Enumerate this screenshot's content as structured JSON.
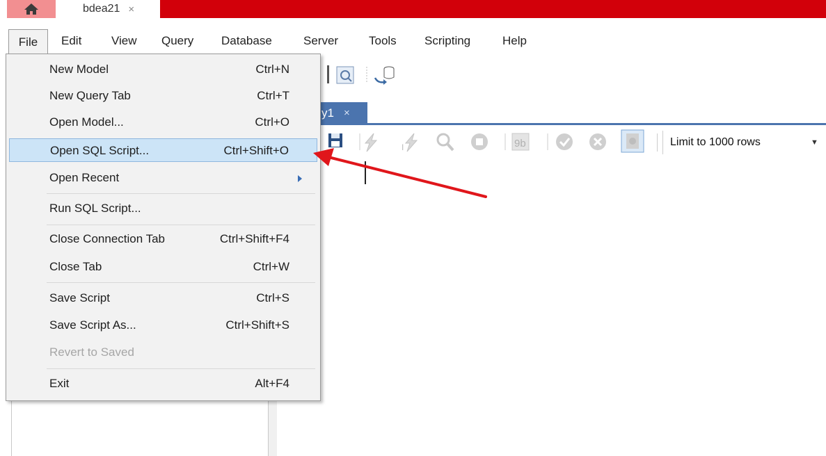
{
  "tabs": {
    "home_label": "",
    "connection_tab": "bdea21",
    "close_glyph": "×"
  },
  "menubar": {
    "items": [
      "File",
      "Edit",
      "View",
      "Query",
      "Database",
      "Server",
      "Tools",
      "Scripting",
      "Help"
    ]
  },
  "file_menu": {
    "items": [
      {
        "label": "New Model",
        "shortcut": "Ctrl+N"
      },
      {
        "label": "New Query Tab",
        "shortcut": "Ctrl+T"
      },
      {
        "label": "Open Model...",
        "shortcut": "Ctrl+O"
      },
      {
        "label": "Open SQL Script...",
        "shortcut": "Ctrl+Shift+O",
        "highlighted": true
      },
      {
        "label": "Open Recent",
        "shortcut": "",
        "submenu": true
      },
      {
        "label": "Run SQL Script...",
        "shortcut": ""
      },
      {
        "label": "Close Connection Tab",
        "shortcut": "Ctrl+Shift+F4"
      },
      {
        "label": "Close Tab",
        "shortcut": "Ctrl+W"
      },
      {
        "label": "Save Script",
        "shortcut": "Ctrl+S"
      },
      {
        "label": "Save Script As...",
        "shortcut": "Ctrl+Shift+S"
      },
      {
        "label": "Revert to Saved",
        "shortcut": "",
        "disabled": true
      },
      {
        "label": "Exit",
        "shortcut": "Alt+F4"
      }
    ]
  },
  "editor": {
    "doc_tab_label": "y1",
    "limit_rows": "Limit to 1000 rows"
  },
  "colors": {
    "brand_red": "#d2000a",
    "highlight": "#cce4f7",
    "annotation_arrow": "#e0161b",
    "tab_blue": "#4b74ae"
  }
}
